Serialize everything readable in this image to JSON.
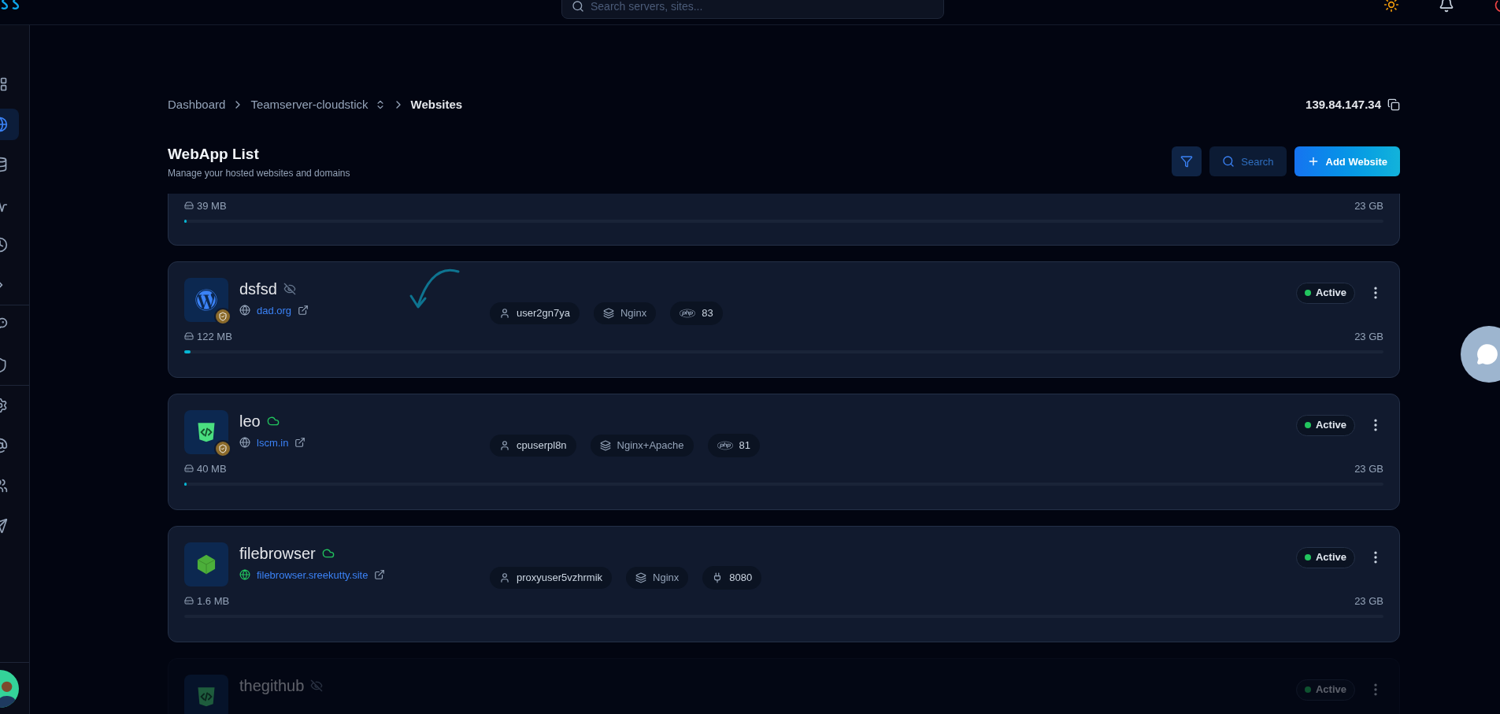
{
  "topbar": {
    "search": {
      "placeholder": "Search servers, sites..."
    }
  },
  "sidebar": {
    "groups": [
      {
        "items": [
          {
            "selected": false
          },
          {
            "selected": true
          },
          {
            "selected": false
          },
          {
            "selected": false
          },
          {
            "selected": false
          },
          {
            "selected": false
          }
        ]
      },
      {
        "items": [
          {
            "selected": false
          },
          {
            "selected": false
          }
        ]
      },
      {
        "items": [
          {
            "selected": false
          },
          {
            "selected": false
          },
          {
            "selected": false
          },
          {
            "selected": false
          }
        ]
      }
    ]
  },
  "breadcrumb": [
    {
      "label": "Dashboard",
      "kind": "link"
    },
    {
      "label": "Teamserver-cloudstick",
      "kind": "switcher"
    },
    {
      "label": "Websites",
      "kind": "current"
    }
  ],
  "server_ip": "139.84.147.34",
  "header": {
    "title": "WebApp List",
    "subtitle": "Manage your hosted websites and domains",
    "search_button": "Search",
    "add_button": "Add Website"
  },
  "partial_card": {
    "storage_used": "39 MB",
    "storage_total": "23 GB",
    "level": 0.002
  },
  "sites": [
    {
      "name": "dsfsd",
      "sync": {
        "kind": "hidden"
      },
      "app": {
        "kind": "wordpress"
      },
      "secured": true,
      "domain": "dad.org",
      "user": "user2gn7ya",
      "stack": "Nginx",
      "extra": {
        "kind": "php",
        "value": "83"
      },
      "status": {
        "kind": "active",
        "label": "Active"
      },
      "storage_used": "122 MB",
      "storage_total": "23 GB",
      "level": 0.005
    },
    {
      "name": "leo",
      "sync": {
        "kind": "cloud"
      },
      "app": {
        "kind": "php"
      },
      "secured": true,
      "domain": "lscm.in",
      "user": "cpuserpl8n",
      "stack": "Nginx+Apache",
      "extra": {
        "kind": "php",
        "value": "81"
      },
      "status": {
        "kind": "active",
        "label": "Active"
      },
      "storage_used": "40 MB",
      "storage_total": "23 GB",
      "level": 0.002
    },
    {
      "name": "filebrowser",
      "sync": {
        "kind": "cloud"
      },
      "app": {
        "kind": "node"
      },
      "secured": false,
      "domain": "filebrowser.sreekutty.site",
      "user": "proxyuser5vzhrmik",
      "stack": "Nginx",
      "extra": {
        "kind": "port",
        "value": "8080"
      },
      "status": {
        "kind": "active",
        "label": "Active"
      },
      "storage_used": "1.6 MB",
      "storage_total": "23 GB",
      "level": 0
    }
  ],
  "faded_card": {
    "name": "thegithub",
    "sync": {
      "kind": "hidden"
    },
    "app": {
      "kind": "php"
    },
    "status": {
      "kind": "active",
      "label": "Active"
    }
  }
}
